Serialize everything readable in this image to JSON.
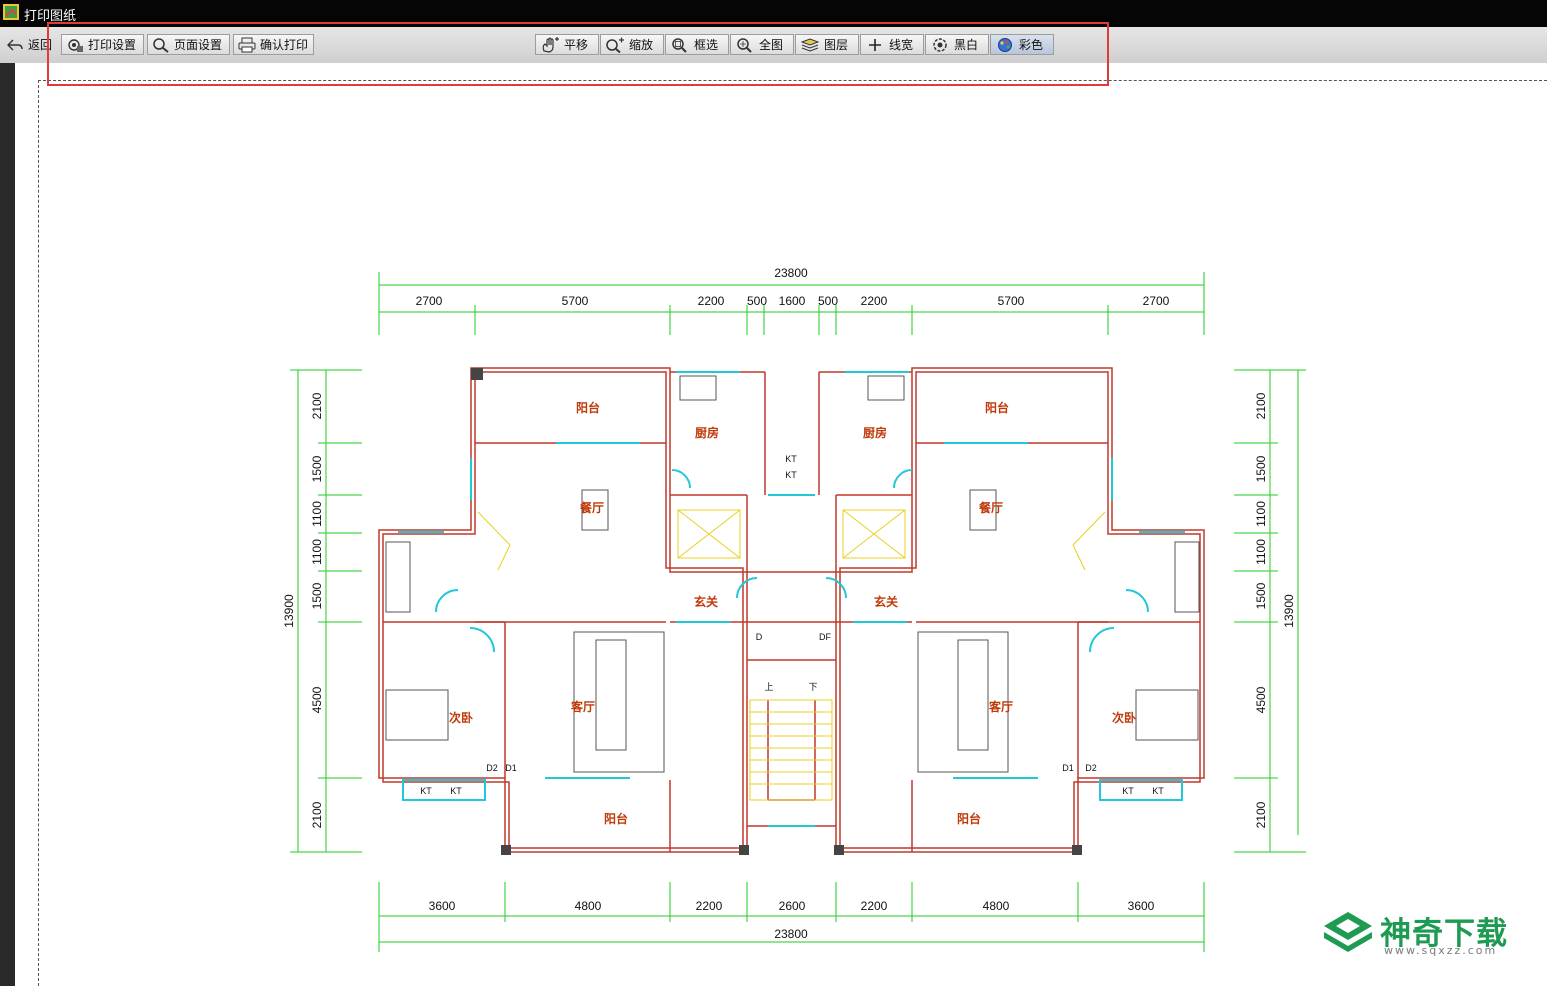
{
  "window": {
    "title": "打印图纸"
  },
  "toolbar": {
    "back": "返回",
    "print_settings": "打印设置",
    "page_settings": "页面设置",
    "confirm_print": "确认打印",
    "pan": "平移",
    "zoom": "缩放",
    "box_select": "框选",
    "full_view": "全图",
    "layers": "图层",
    "line_width": "线宽",
    "black_white": "黑白",
    "color": "彩色"
  },
  "plan": {
    "overall_width": "23800",
    "overall_height": "13900",
    "top_dims": [
      "2700",
      "5700",
      "2200",
      "500",
      "1600",
      "500",
      "2200",
      "5700",
      "2700"
    ],
    "bottom_dims": [
      "3600",
      "4800",
      "2200",
      "2600",
      "2200",
      "4800",
      "3600"
    ],
    "left_dims": [
      "2100",
      "1500",
      "1100",
      "1100",
      "1500",
      "4500",
      "2100"
    ],
    "right_dims": [
      "2100",
      "1500",
      "1100",
      "1100",
      "1500",
      "4500",
      "2100"
    ],
    "rooms": {
      "balcony": "阳台",
      "kitchen": "厨房",
      "dining": "餐厅",
      "foyer": "玄关",
      "living": "客厅",
      "bedroom2": "次卧"
    },
    "tags": {
      "kt": "KT",
      "d1": "D1",
      "d2": "D2",
      "d": "D",
      "df": "DF",
      "up": "上",
      "down": "下"
    }
  },
  "watermark": {
    "brand": "神奇下载",
    "url": "www.sqxzz.com"
  },
  "colors": {
    "accent_green": "#1e9a52",
    "highlight_red": "#e03a3a",
    "plan_wall": "#c0392b",
    "dim_green": "#22cc22"
  }
}
